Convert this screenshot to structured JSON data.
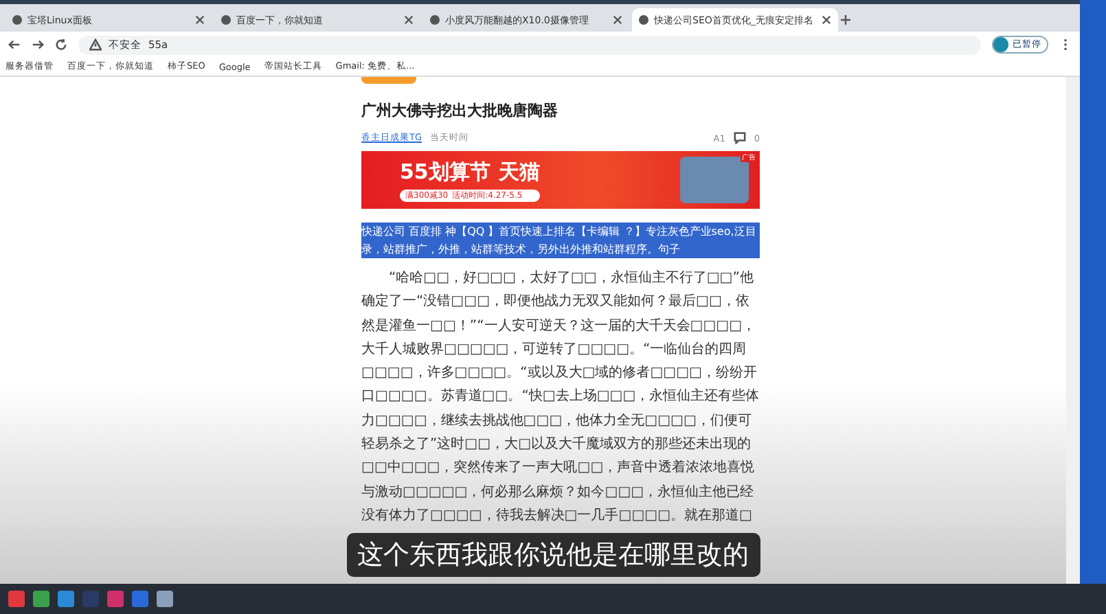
{
  "tabs": [
    {
      "label": "宝塔Linux面板",
      "selected": false
    },
    {
      "label": "百度一下，你就知道",
      "selected": false
    },
    {
      "label": "小度风万能翻越的X10.0摄像管理",
      "selected": false
    },
    {
      "label": "快递公司SEO首页优化_无痕安定排名",
      "selected": true
    }
  ],
  "address": {
    "security": "不安全",
    "url": "55a"
  },
  "profile": {
    "label": "已暂停"
  },
  "bookmarks": [
    {
      "label": "服务器借管"
    },
    {
      "label": "百度一下，你就知道"
    },
    {
      "label": "柿子SEO"
    },
    {
      "label": "Google"
    },
    {
      "label": "帝国站长工具"
    },
    {
      "label": "Gmail: 免费、私..."
    }
  ],
  "article": {
    "title": "广州大佛寺挖出大批晚唐陶器",
    "author": "香主日成果TG",
    "time": "当天时间",
    "font_label": "A1",
    "comments": "0",
    "banner": {
      "headline": "55划算节",
      "brand": "天猫",
      "promo": "满300减30",
      "dates": "活动时间:4.27-5.5",
      "ad_label": "广告"
    },
    "highlight": "快递公司 百度排 神【QQ 】首页快速上排名【卡编辑 ？】专注灰色产业seo,泛目录，站群推广，外推，站群等技术，另外出外推和站群程序。句子",
    "body": "“哈哈□□，好□□□，太好了□□，永恒仙主不行了□□”他确定了一“没错□□□，即便他战力无双又能如何？最后□□，依然是灌鱼一□□！”“一人安可逆天？这一届的大千天会□□□□，大千人城败界□□□□□，可逆转了□□□□。“一临仙台的四周□□□□，许多□□□□。“或以及大□域的修者□□□□，纷纷开口□□□□。苏青道□□。“快□去上场□□□，永恒仙主还有些体力□□□□，继续去挑战他□□□，他体力全无□□□□，们便可轻易杀之了”这时□□，大□以及大千魔域双方的那些还未出现的□□中□□□，突然传来了一声大吼□□，声音中透着浓浓地喜悦与激动□□□□□，何必那么麻烦？如今□□□，永恒仙主他已经没有体力了□□□□，待我去解决□一几手□□□□。就在那道□"
  },
  "caption": "这个东西我跟你说他是在哪里改的",
  "taskbar": {
    "apps": [
      {
        "color": "#e0393e"
      },
      {
        "color": "#3aa04a"
      },
      {
        "color": "#2a8ad8"
      },
      {
        "color": "#2a3a66"
      },
      {
        "color": "#d0306a"
      },
      {
        "color": "#2a6ad8"
      },
      {
        "color": "#8aa0b8"
      }
    ]
  }
}
